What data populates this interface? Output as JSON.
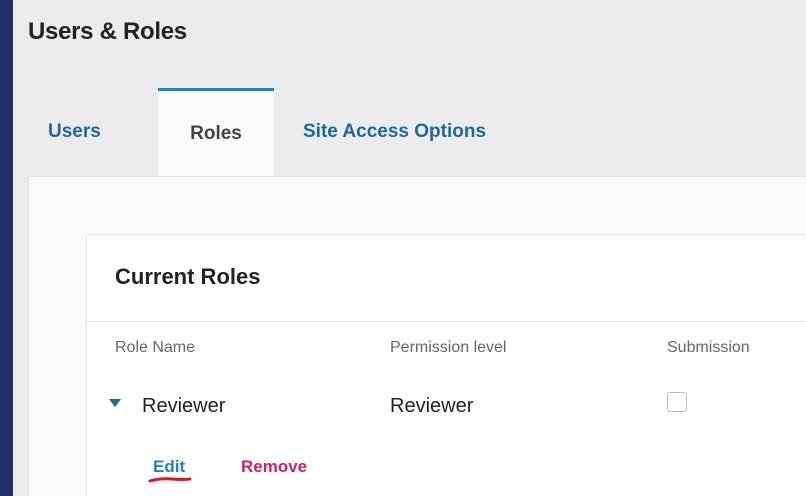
{
  "page": {
    "title": "Users & Roles"
  },
  "tabs": [
    {
      "label": "Users",
      "active": false
    },
    {
      "label": "Roles",
      "active": true
    },
    {
      "label": "Site Access Options",
      "active": false
    }
  ],
  "current_roles": {
    "title": "Current Roles",
    "columns": [
      "Role Name",
      "Permission level",
      "Submission"
    ],
    "rows": [
      {
        "role_name": "Reviewer",
        "permission_level": "Reviewer",
        "submission_checked": false,
        "expanded": true,
        "actions": {
          "edit": "Edit",
          "remove": "Remove"
        }
      }
    ]
  },
  "colors": {
    "background_outer": "#1f2f6b",
    "link": "#1c6a9e",
    "edit": "#1c84c6",
    "remove": "#d01f6d",
    "annotation": "#e0141e"
  },
  "icons": {
    "row_toggle": "caret-down-icon"
  }
}
